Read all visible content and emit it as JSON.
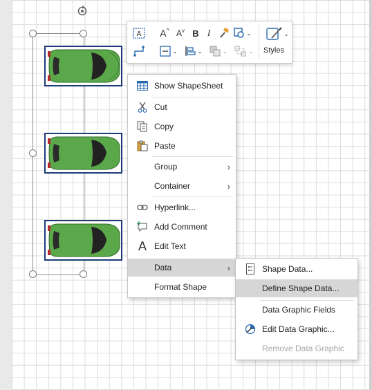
{
  "toolbar": {
    "styles_label": "Styles",
    "font_bold": "B",
    "font_italic": "I",
    "grow_font": "A",
    "shrink_font": "A"
  },
  "context_menu": {
    "items": [
      {
        "label": "Show ShapeSheet",
        "icon": "shapesheet-icon"
      },
      {
        "label": "Cut",
        "icon": "scissors-icon"
      },
      {
        "label": "Copy",
        "icon": "copy-icon"
      },
      {
        "label": "Paste",
        "icon": "paste-icon"
      },
      {
        "label": "Group",
        "icon": "",
        "submenu": true
      },
      {
        "label": "Container",
        "icon": "",
        "submenu": true
      },
      {
        "label": "Hyperlink...",
        "icon": "hyperlink-icon"
      },
      {
        "label": "Add Comment",
        "icon": "comment-icon"
      },
      {
        "label": "Edit Text",
        "icon": "text-icon"
      },
      {
        "label": "Data",
        "icon": "",
        "submenu": true,
        "highlighted": true
      },
      {
        "label": "Format Shape",
        "icon": ""
      }
    ]
  },
  "data_submenu": {
    "items": [
      {
        "label": "Shape Data...",
        "icon": "shape-data-icon"
      },
      {
        "label": "Define Shape Data...",
        "icon": "",
        "highlighted": true
      },
      {
        "label": "Data Graphic Fields",
        "icon": ""
      },
      {
        "label": "Edit Data Graphic...",
        "icon": "edit-data-graphic-icon"
      },
      {
        "label": "Remove Data Graphic",
        "icon": "",
        "disabled": true
      }
    ]
  },
  "colors": {
    "car_body": "#5aa84a",
    "car_frame": "#1c3a78",
    "menu_highlight": "#d6d6d6"
  }
}
